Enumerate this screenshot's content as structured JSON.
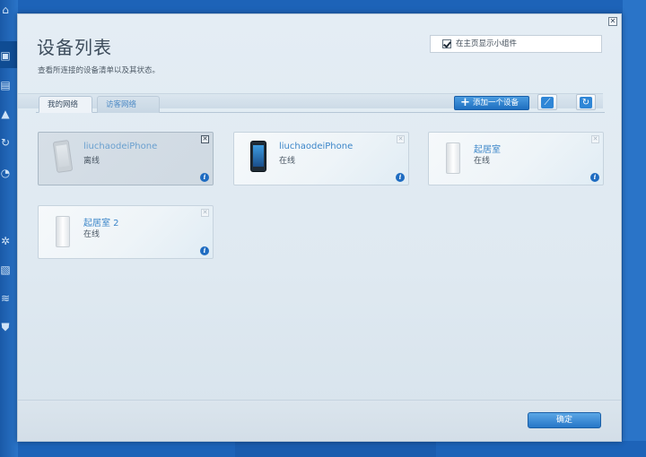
{
  "dialog": {
    "title": "设备列表",
    "subtitle": "查看所连接的设备清单以及其状态。",
    "close_label": "✕"
  },
  "widget_option": {
    "label": "在主页显示小组件",
    "checked": true
  },
  "tabs": [
    {
      "label": "我的网络",
      "active": true
    },
    {
      "label": "访客网络",
      "active": false
    }
  ],
  "toolbar": {
    "add_device_label": "添加一个设备",
    "clean_icon": "broom-icon",
    "refresh_icon": "refresh-icon"
  },
  "devices": [
    {
      "name": "liuchaodeiPhone",
      "status": "离线",
      "icon": "phone-icon",
      "online": false
    },
    {
      "name": "liuchaodeiPhone",
      "status": "在线",
      "icon": "phone-icon",
      "online": true
    },
    {
      "name": "起居室",
      "status": "在线",
      "icon": "router-node-icon",
      "online": true
    },
    {
      "name": "起居室 2",
      "status": "在线",
      "icon": "router-node-icon",
      "online": true
    }
  ],
  "footer": {
    "ok_label": "确定"
  },
  "colors": {
    "accent": "#2676c7",
    "link": "#3c86c9",
    "background": "#1d63b8"
  }
}
